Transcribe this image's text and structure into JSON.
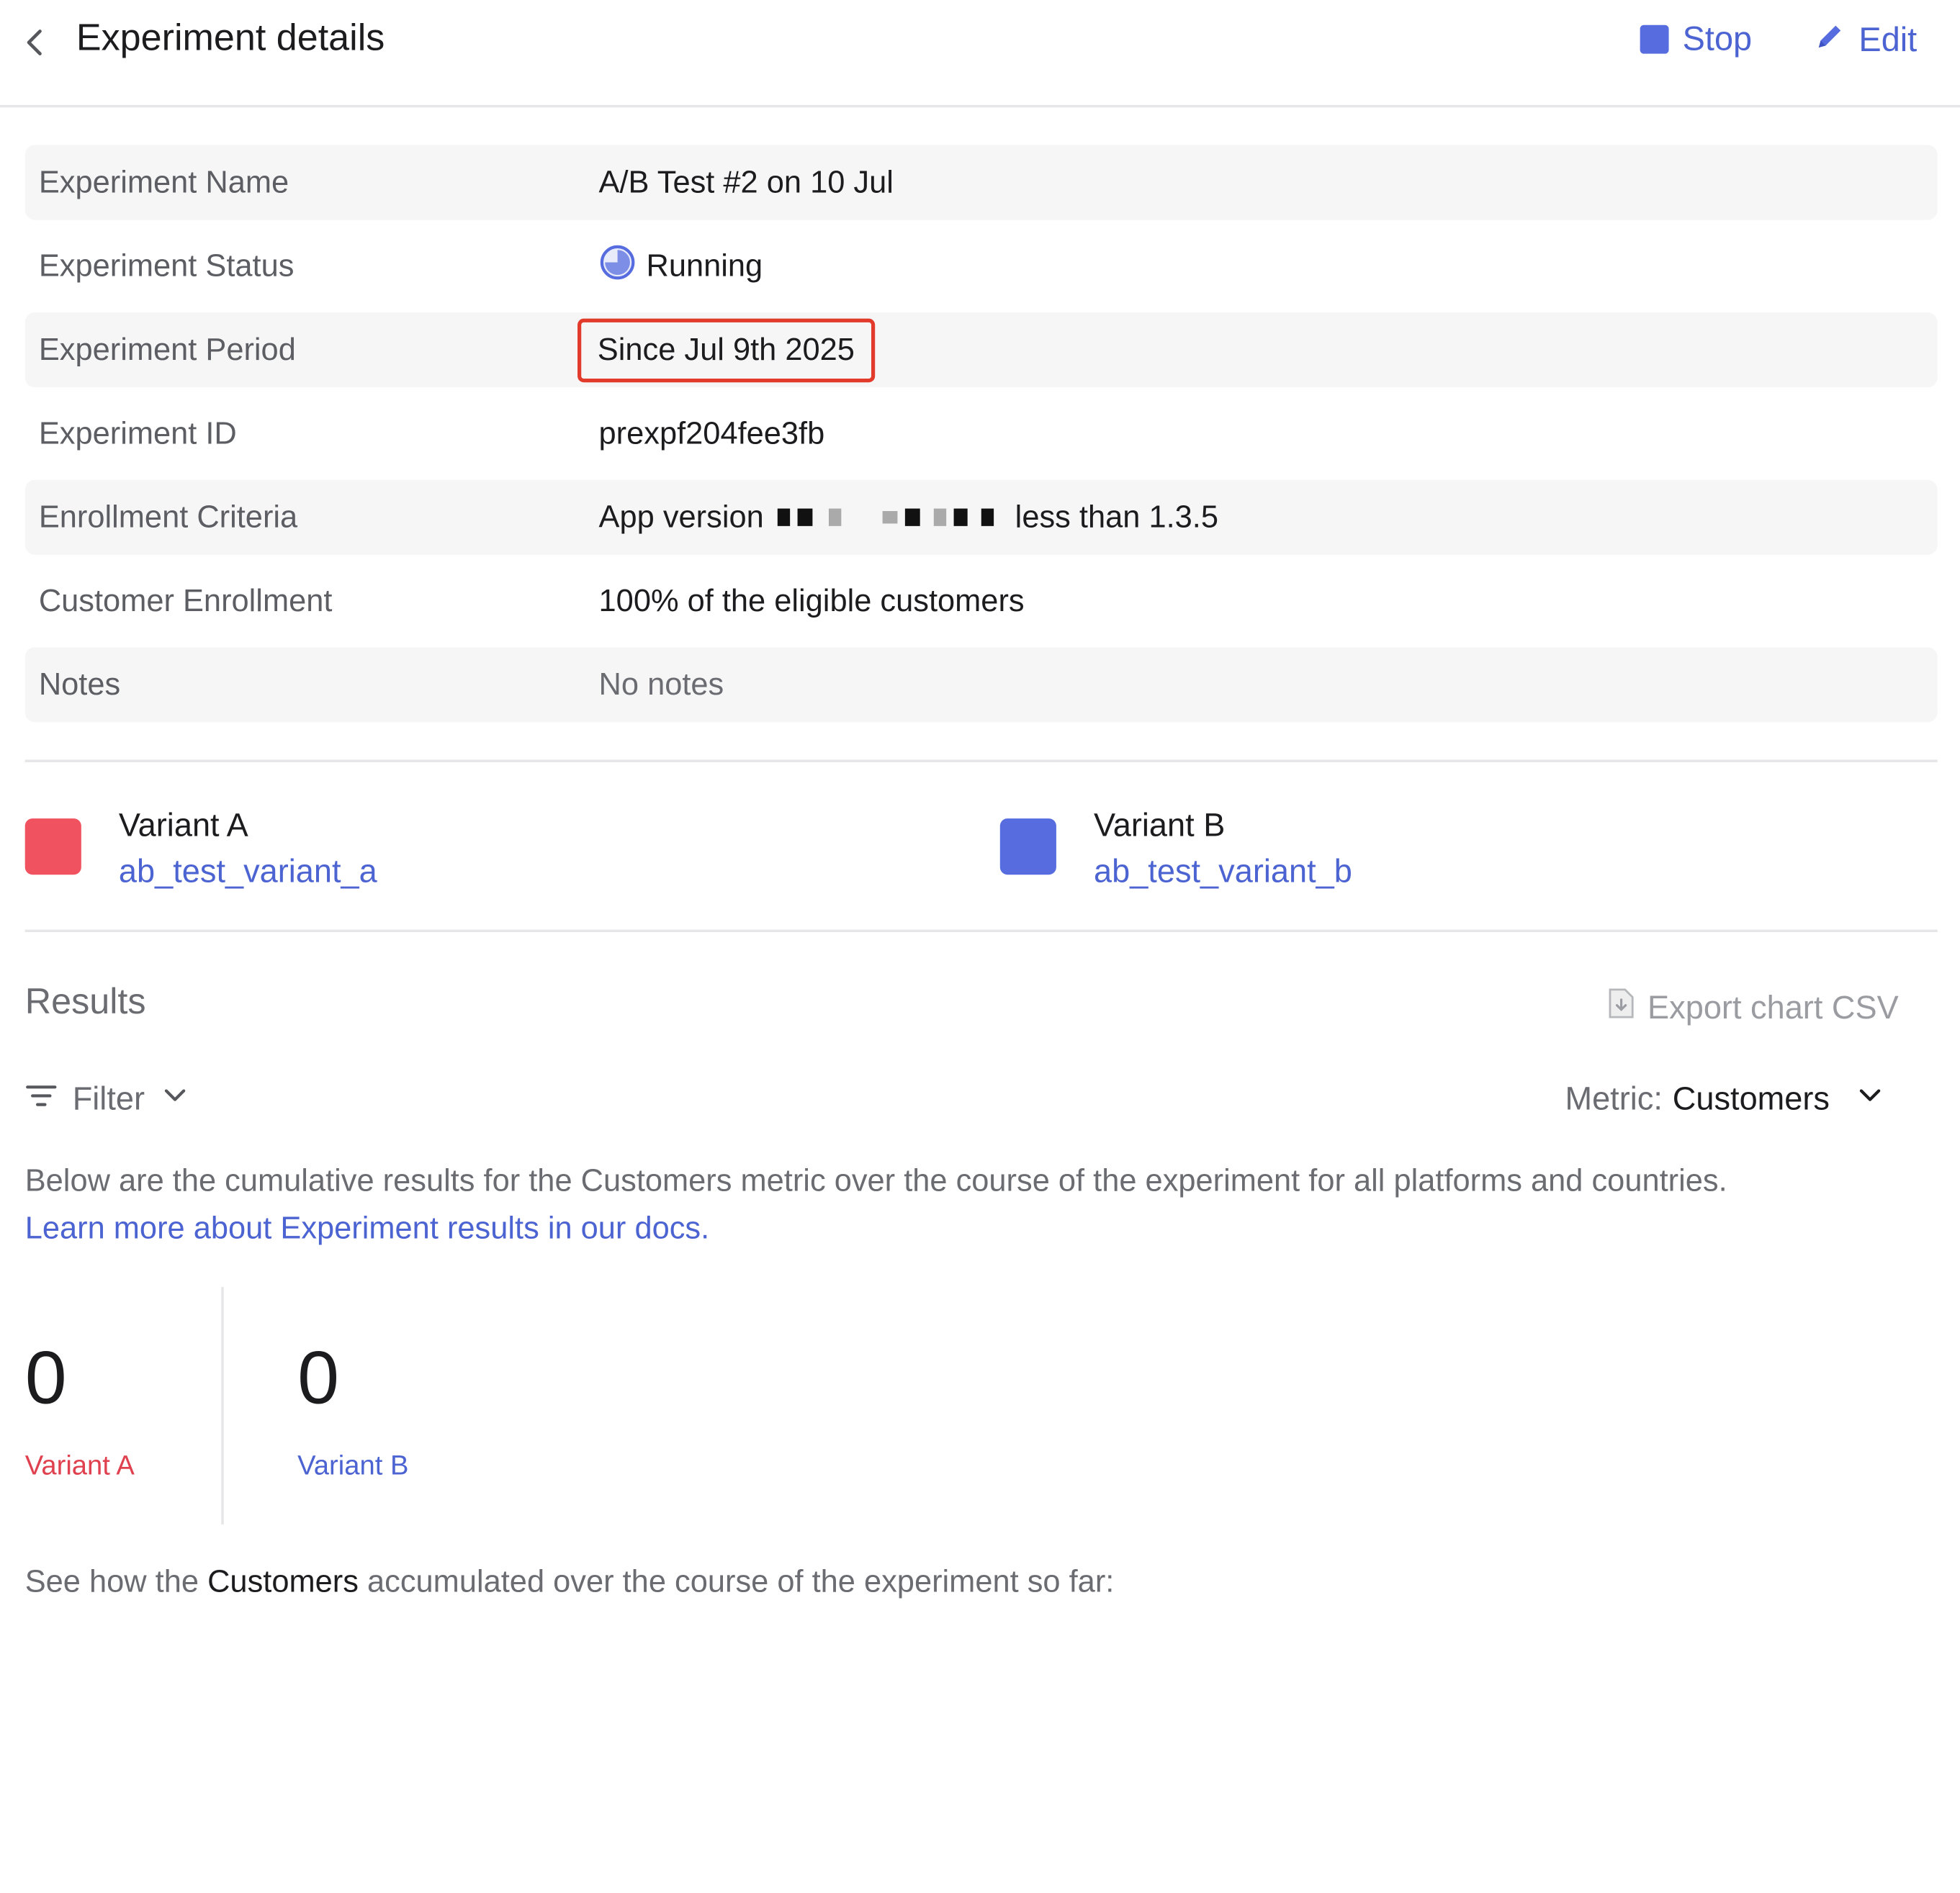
{
  "header": {
    "title": "Experiment details",
    "stop_label": "Stop",
    "edit_label": "Edit"
  },
  "details": [
    {
      "label": "Experiment Name",
      "value": "A/B Test #2 on 10 Jul"
    },
    {
      "label": "Experiment Status",
      "value": "Running"
    },
    {
      "label": "Experiment Period",
      "value": "Since Jul 9th 2025"
    },
    {
      "label": "Experiment ID",
      "value": "prexpf204fee3fb"
    },
    {
      "label": "Enrollment Criteria",
      "value_prefix": "App version",
      "value_suffix": "less than 1.3.5"
    },
    {
      "label": "Customer Enrollment",
      "value": "100% of the eligible customers"
    },
    {
      "label": "Notes",
      "value": "No notes"
    }
  ],
  "variants": [
    {
      "name": "Variant A",
      "key": "ab_test_variant_a",
      "color": "#f0525f"
    },
    {
      "name": "Variant B",
      "key": "ab_test_variant_b",
      "color": "#576ddf"
    }
  ],
  "results": {
    "title": "Results",
    "export_label": "Export chart CSV",
    "filter_label": "Filter",
    "metric_prefix": "Metric:",
    "metric_value": "Customers",
    "description": "Below are the cumulative results for the Customers metric over the course of the experiment for all platforms and countries.",
    "docs_link": "Learn more about Experiment results in our docs.",
    "stats": [
      {
        "value": "0",
        "label": "Variant A",
        "color": "#e0414f"
      },
      {
        "value": "0",
        "label": "Variant B",
        "color": "#4c63d2"
      }
    ],
    "sofar_prefix": "See how the",
    "sofar_metric": "Customers",
    "sofar_suffix": "accumulated over the course of the experiment so far:"
  },
  "colors": {
    "accent": "#4c63d2",
    "highlight_border": "#e23a2b"
  }
}
